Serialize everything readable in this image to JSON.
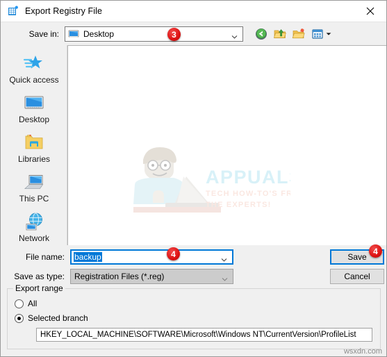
{
  "window": {
    "title": "Export Registry File",
    "title_icon": "registry-editor-icon",
    "close_icon": "close-icon"
  },
  "savein": {
    "label": "Save in:",
    "value": "Desktop",
    "value_icon": "desktop-monitor-icon",
    "dropdown_icon": "chevron-down-icon",
    "toolbar": [
      {
        "name": "back-icon",
        "label": "Back"
      },
      {
        "name": "up-one-level-icon",
        "label": "Up One Level"
      },
      {
        "name": "new-folder-icon",
        "label": "Create New Folder"
      },
      {
        "name": "views-icon",
        "label": "Views"
      }
    ]
  },
  "places": [
    {
      "label": "Quick access",
      "icon": "quick-access-star-icon"
    },
    {
      "label": "Desktop",
      "icon": "desktop-monitor-icon"
    },
    {
      "label": "Libraries",
      "icon": "libraries-folder-icon"
    },
    {
      "label": "This PC",
      "icon": "this-pc-computer-icon"
    },
    {
      "label": "Network",
      "icon": "network-globe-icon"
    }
  ],
  "file_list": {
    "items": [],
    "watermark_title": "APPUALS",
    "watermark_sub1": "TECH HOW-TO'S FROM",
    "watermark_sub2": "THE EXPERTS!"
  },
  "form": {
    "filename_label": "File name:",
    "filename_value": "backup",
    "filetype_label": "Save as type:",
    "filetype_value": "Registration Files (*.reg)",
    "save_label": "Save",
    "cancel_label": "Cancel"
  },
  "export_range": {
    "legend": "Export range",
    "option_all": "All",
    "option_selected": "Selected branch",
    "selected_option": "Selected branch",
    "branch_path": "HKEY_LOCAL_MACHINE\\SOFTWARE\\Microsoft\\Windows NT\\CurrentVersion\\ProfileList"
  },
  "annotations": {
    "badge_savein": "3",
    "badge_filename": "4",
    "badge_save": "4"
  },
  "watermark_site": "wsxdn.com",
  "colors": {
    "accent": "#0078d7",
    "badge_red": "#e01616",
    "dialog_bg": "#f0f0f0"
  }
}
